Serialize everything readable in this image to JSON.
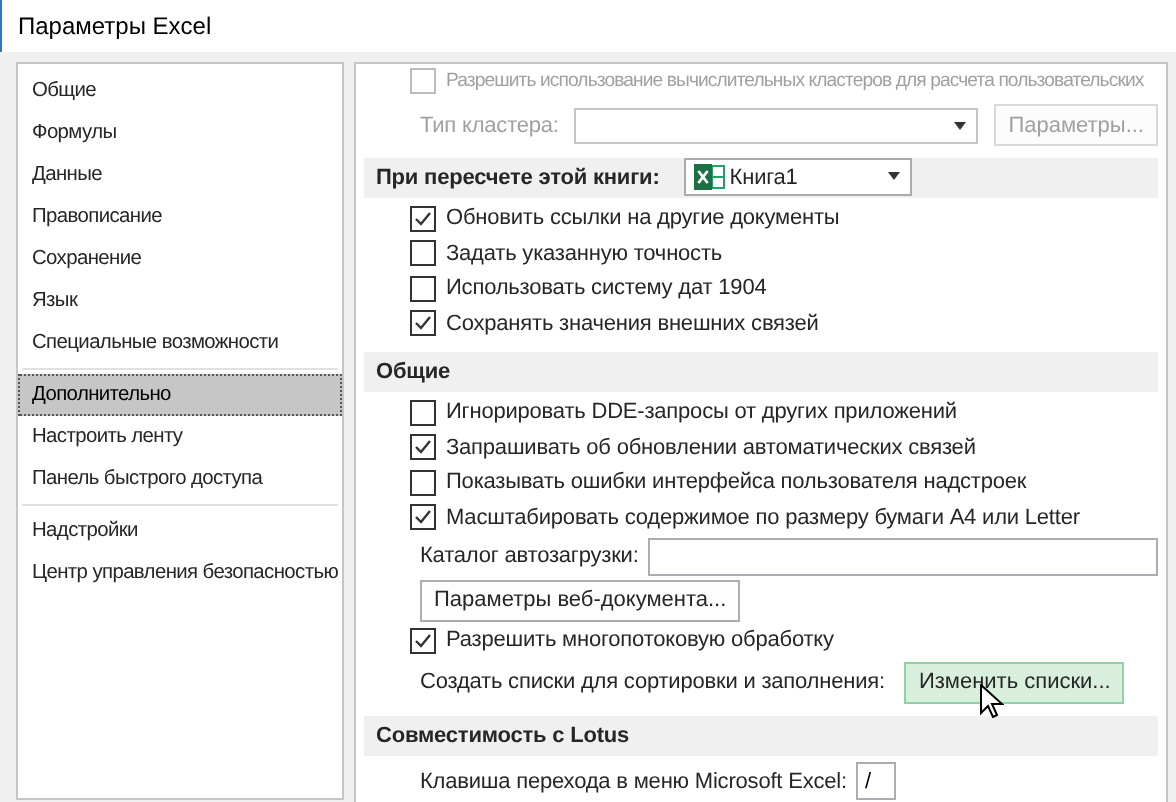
{
  "window": {
    "title": "Параметры Excel"
  },
  "sidebar": {
    "groups": [
      [
        {
          "label": "Общие",
          "selected": false
        },
        {
          "label": "Формулы",
          "selected": false
        },
        {
          "label": "Данные",
          "selected": false
        },
        {
          "label": "Правописание",
          "selected": false
        },
        {
          "label": "Сохранение",
          "selected": false
        },
        {
          "label": "Язык",
          "selected": false
        },
        {
          "label": "Специальные возможности",
          "selected": false
        }
      ],
      [
        {
          "label": "Дополнительно",
          "selected": true
        },
        {
          "label": "Настроить ленту",
          "selected": false
        },
        {
          "label": "Панель быстрого доступа",
          "selected": false
        }
      ],
      [
        {
          "label": "Надстройки",
          "selected": false
        },
        {
          "label": "Центр управления безопасностью",
          "selected": false
        }
      ]
    ]
  },
  "content": {
    "rows": [
      {
        "kind": "checkbox",
        "label": "Разрешить использование вычислительных кластеров для расчета пользовательских",
        "checked": false,
        "disabled": true
      },
      {
        "kind": "combo",
        "label": "Тип кластера:",
        "button": "Параметры...",
        "disabled": true
      },
      {
        "kind": "header",
        "label": "При пересчете этой книги:",
        "dropdown": "Книга1"
      },
      {
        "kind": "checkbox",
        "label": "Обновить ссылки на другие документы",
        "checked": true,
        "disabled": false
      },
      {
        "kind": "checkbox",
        "label": "Задать указанную точность",
        "checked": false,
        "disabled": false
      },
      {
        "kind": "checkbox",
        "label": "Использовать систему дат 1904",
        "checked": false,
        "disabled": false
      },
      {
        "kind": "checkbox",
        "label": "Сохранять значения внешних связей",
        "checked": true,
        "disabled": false
      },
      {
        "kind": "header",
        "label": "Общие"
      },
      {
        "kind": "checkbox",
        "label": "Игнорировать DDE-запросы от других приложений",
        "checked": false,
        "disabled": false
      },
      {
        "kind": "checkbox",
        "label": "Запрашивать об обновлении автоматических связей",
        "checked": true,
        "disabled": false
      },
      {
        "kind": "checkbox",
        "label": "Показывать ошибки интерфейса пользователя надстроек",
        "checked": false,
        "disabled": false
      },
      {
        "kind": "checkbox",
        "label": "Масштабировать содержимое по размеру бумаги A4 или Letter",
        "checked": true,
        "disabled": false
      },
      {
        "kind": "field",
        "label": "Каталог автозагрузки:"
      },
      {
        "kind": "button",
        "label": "Параметры веб-документа...",
        "hovered": false
      },
      {
        "kind": "checkbox",
        "label": "Разрешить многопотоковую обработку",
        "checked": true,
        "disabled": false
      },
      {
        "kind": "label_button",
        "label": "Создать списки для сортировки и заполнения:",
        "button": "Изменить списки...",
        "hovered": true
      },
      {
        "kind": "header",
        "label": "Совместимость с Lotus"
      },
      {
        "kind": "short_field",
        "label": "Клавиша перехода в меню Microsoft Excel:",
        "value": "/"
      }
    ]
  }
}
